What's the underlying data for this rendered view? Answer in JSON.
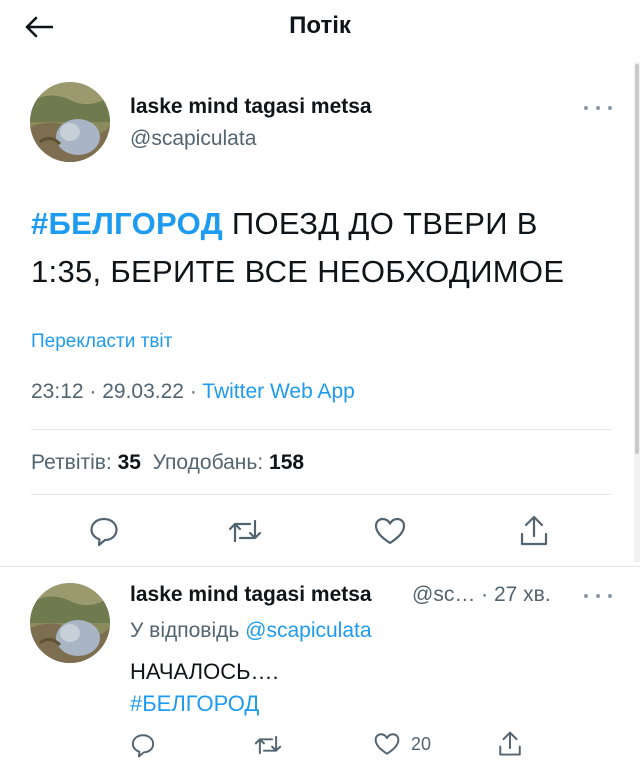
{
  "header": {
    "title": "Потік"
  },
  "tweet": {
    "author_name": "laske mind tagasi metsa",
    "author_handle": "@scapiculata",
    "hashtag": "#БЕЛГОРОД",
    "text": " ПОЕЗД ДО ТВЕРИ В 1:35, БЕРИТЕ ВСЕ НЕОБХОДИМОЕ",
    "translate_label": "Перекласти твіт",
    "time": "23:12",
    "date": "29.03.22",
    "source": "Twitter Web App",
    "separator": " · ",
    "retweets_label": "Ретвітів:",
    "retweets_count": "35",
    "likes_label": "Уподобань:",
    "likes_count": "158"
  },
  "reply": {
    "author_name": "laske mind tagasi metsa",
    "author_handle": "@sc…",
    "time_ago": " · 27 хв.",
    "reply_prefix": "У відповідь ",
    "reply_mention": "@scapiculata",
    "text": "НАЧАЛОСЬ….",
    "hashtag": "#БЕЛГОРОД",
    "like_count": "20"
  },
  "icons": {
    "back": "arrow-left-icon",
    "more": "more-horizontal-icon",
    "reply": "reply-bubble-icon",
    "retweet": "retweet-icon",
    "like": "heart-icon",
    "share": "share-icon"
  },
  "colors": {
    "accent": "#1d9bf0",
    "secondary_text": "#536471",
    "primary_text": "#0f1419"
  }
}
